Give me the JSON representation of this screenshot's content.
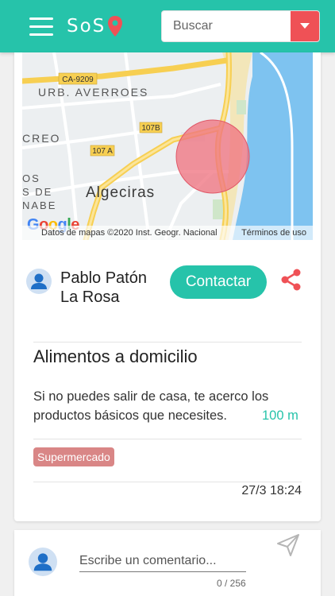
{
  "header": {
    "logo_text": "SoS",
    "search_placeholder": "Buscar",
    "brand_color": "#26c3aa",
    "accent_color": "#ef5156"
  },
  "map": {
    "labels": [
      "CA-9209",
      "URB. AVERROES",
      "CREO",
      "107B",
      "107 A",
      "OS",
      "S DE",
      "NABE",
      "Algeciras"
    ],
    "google_text": "Google",
    "attribution": "Datos de mapas ©2020 Inst. Geogr. Nacional",
    "terms": "Términos de uso"
  },
  "post": {
    "author": "Pablo Patón La Rosa",
    "contact_label": "Contactar",
    "title": "Alimentos a domicilio",
    "description": "Si no puedes salir de casa, te acerco los productos básicos que necesites.",
    "distance": "100 m",
    "tag": "Supermercado",
    "date": "27/3 18:24"
  },
  "comment": {
    "placeholder": "Escribe un comentario...",
    "counter": "0 / 256"
  },
  "icons": [
    "menu-icon",
    "location-pin-icon",
    "chevron-down-icon",
    "user-icon",
    "share-icon",
    "send-icon"
  ]
}
